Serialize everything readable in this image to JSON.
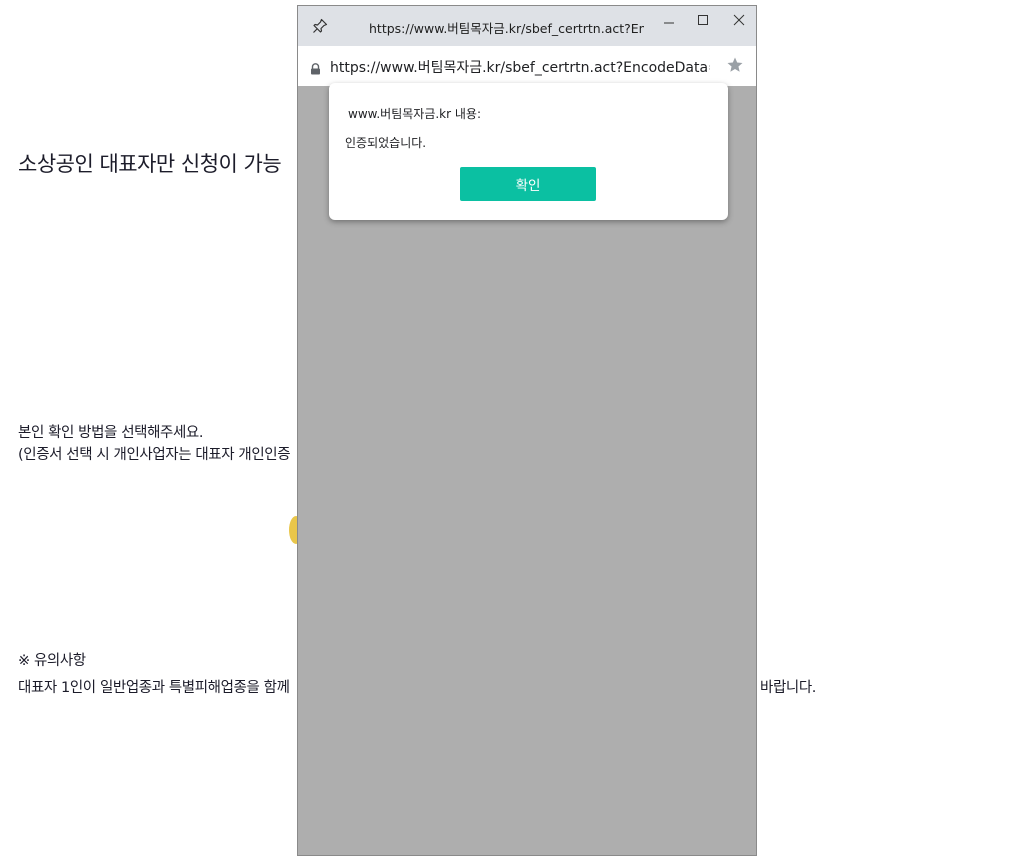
{
  "background_page": {
    "title": "소상공인 대표자만 신청이 가능",
    "instruction_line1": "본인 확인 방법을 선택해주세요.",
    "instruction_line2": "(인증서 선택 시 개인사업자는 대표자 개인인증",
    "notes_heading": "※ 유의사항",
    "notes_line": "대표자 1인이 일반업종과 특별피해업종을 함께",
    "notes_tail": "바랍니다."
  },
  "popup": {
    "title": "https://www.버팀목자금.kr/sbef_certrtn.act?Enco...",
    "url": "https://www.버팀목자금.kr/sbef_certrtn.act?EncodeData=Ag/",
    "icons": {
      "pin": "pin-icon",
      "minimize": "minimize-icon",
      "maximize": "maximize-icon",
      "close": "close-icon",
      "lock": "lock-icon",
      "bookmark": "star-icon"
    }
  },
  "dialog": {
    "origin": "www.버팀목자금.kr 내용:",
    "message": "인증되었습니다.",
    "ok_label": "확인",
    "ok_color": "#0bc0a2"
  }
}
